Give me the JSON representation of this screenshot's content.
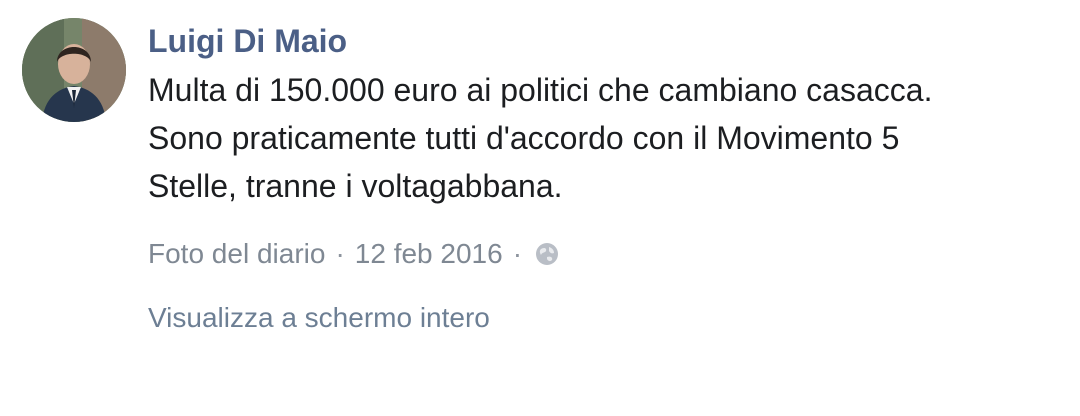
{
  "post": {
    "author": "Luigi Di Maio",
    "message": "Multa di 150.000 euro ai politici che cambiano casacca.\nSono praticamente tutti d'accordo con il Movimento 5\nStelle, tranne i voltagabbana.",
    "meta": {
      "source": "Foto del diario",
      "separator": "·",
      "date": "12 feb 2016",
      "privacy_icon": "globe-icon"
    },
    "fullscreen_link": "Visualizza a schermo intero"
  },
  "colors": {
    "author": "#4b5f86",
    "text": "#1c1e21",
    "meta": "#7f8893",
    "link": "#6d7f94"
  }
}
